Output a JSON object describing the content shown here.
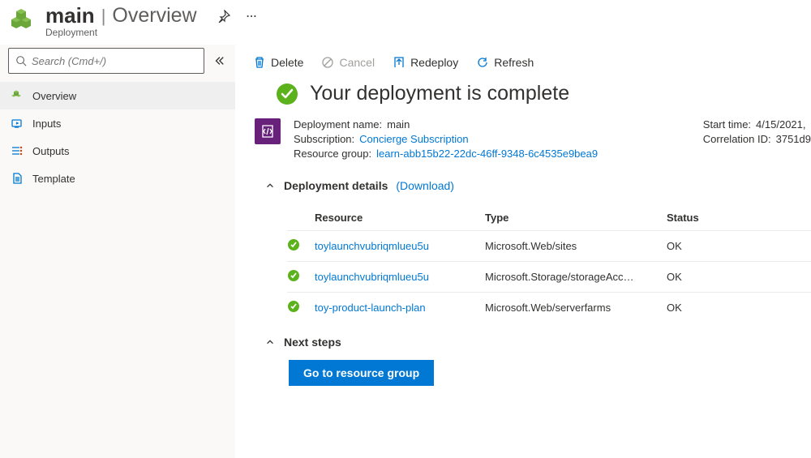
{
  "header": {
    "title_main": "main",
    "title_sub": "Overview",
    "subtitle": "Deployment"
  },
  "sidebar": {
    "search_placeholder": "Search (Cmd+/)",
    "items": [
      {
        "label": "Overview",
        "active": true
      },
      {
        "label": "Inputs",
        "active": false
      },
      {
        "label": "Outputs",
        "active": false
      },
      {
        "label": "Template",
        "active": false
      }
    ]
  },
  "toolbar": {
    "delete": "Delete",
    "cancel": "Cancel",
    "redeploy": "Redeploy",
    "refresh": "Refresh"
  },
  "banner": {
    "message": "Your deployment is complete"
  },
  "meta": {
    "deployment_label": "Deployment name:",
    "deployment_value": "main",
    "subscription_label": "Subscription:",
    "subscription_value": "Concierge Subscription",
    "resourcegroup_label": "Resource group:",
    "resourcegroup_value": "learn-abb15b22-22dc-46ff-9348-6c4535e9bea9",
    "starttime_label": "Start time:",
    "starttime_value": "4/15/2021,",
    "correlation_label": "Correlation ID:",
    "correlation_value": "3751d9"
  },
  "details": {
    "title": "Deployment details",
    "download": "(Download)",
    "columns": {
      "resource": "Resource",
      "type": "Type",
      "status": "Status"
    },
    "rows": [
      {
        "resource": "toylaunchvubriqmlueu5u",
        "type": "Microsoft.Web/sites",
        "status": "OK"
      },
      {
        "resource": "toylaunchvubriqmlueu5u",
        "type": "Microsoft.Storage/storageAcc…",
        "status": "OK"
      },
      {
        "resource": "toy-product-launch-plan",
        "type": "Microsoft.Web/serverfarms",
        "status": "OK"
      }
    ]
  },
  "nextsteps": {
    "title": "Next steps",
    "button": "Go to resource group"
  }
}
